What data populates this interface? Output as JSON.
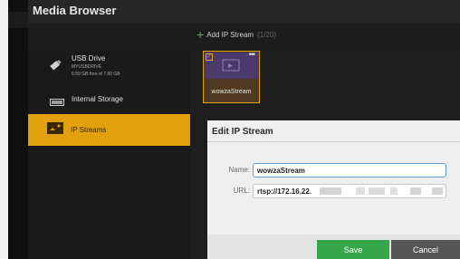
{
  "app": {
    "title": "Media Browser"
  },
  "toolbar": {
    "add_label": "Add IP Stream",
    "count": "(1/20)"
  },
  "sidebar": {
    "usb": {
      "name": "USB Drive",
      "id": "MYUSBDRIVE",
      "free": "6.59 GB free of 7.60 GB"
    },
    "internal": {
      "name": "Internal Storage"
    },
    "ipstreams": {
      "name": "IP Streams"
    }
  },
  "tile": {
    "label": "wowzaStream"
  },
  "dialog": {
    "title": "Edit IP Stream",
    "name_label": "Name:",
    "name_value": "wowzaStream",
    "url_label": "URL:",
    "url_value": "rtsp://172.16.22.",
    "save": "Save",
    "cancel": "Cancel"
  },
  "colors": {
    "accent": "#e1a10f",
    "save": "#36a64a",
    "cancel": "#555555",
    "focus": "#5aa0d6"
  }
}
